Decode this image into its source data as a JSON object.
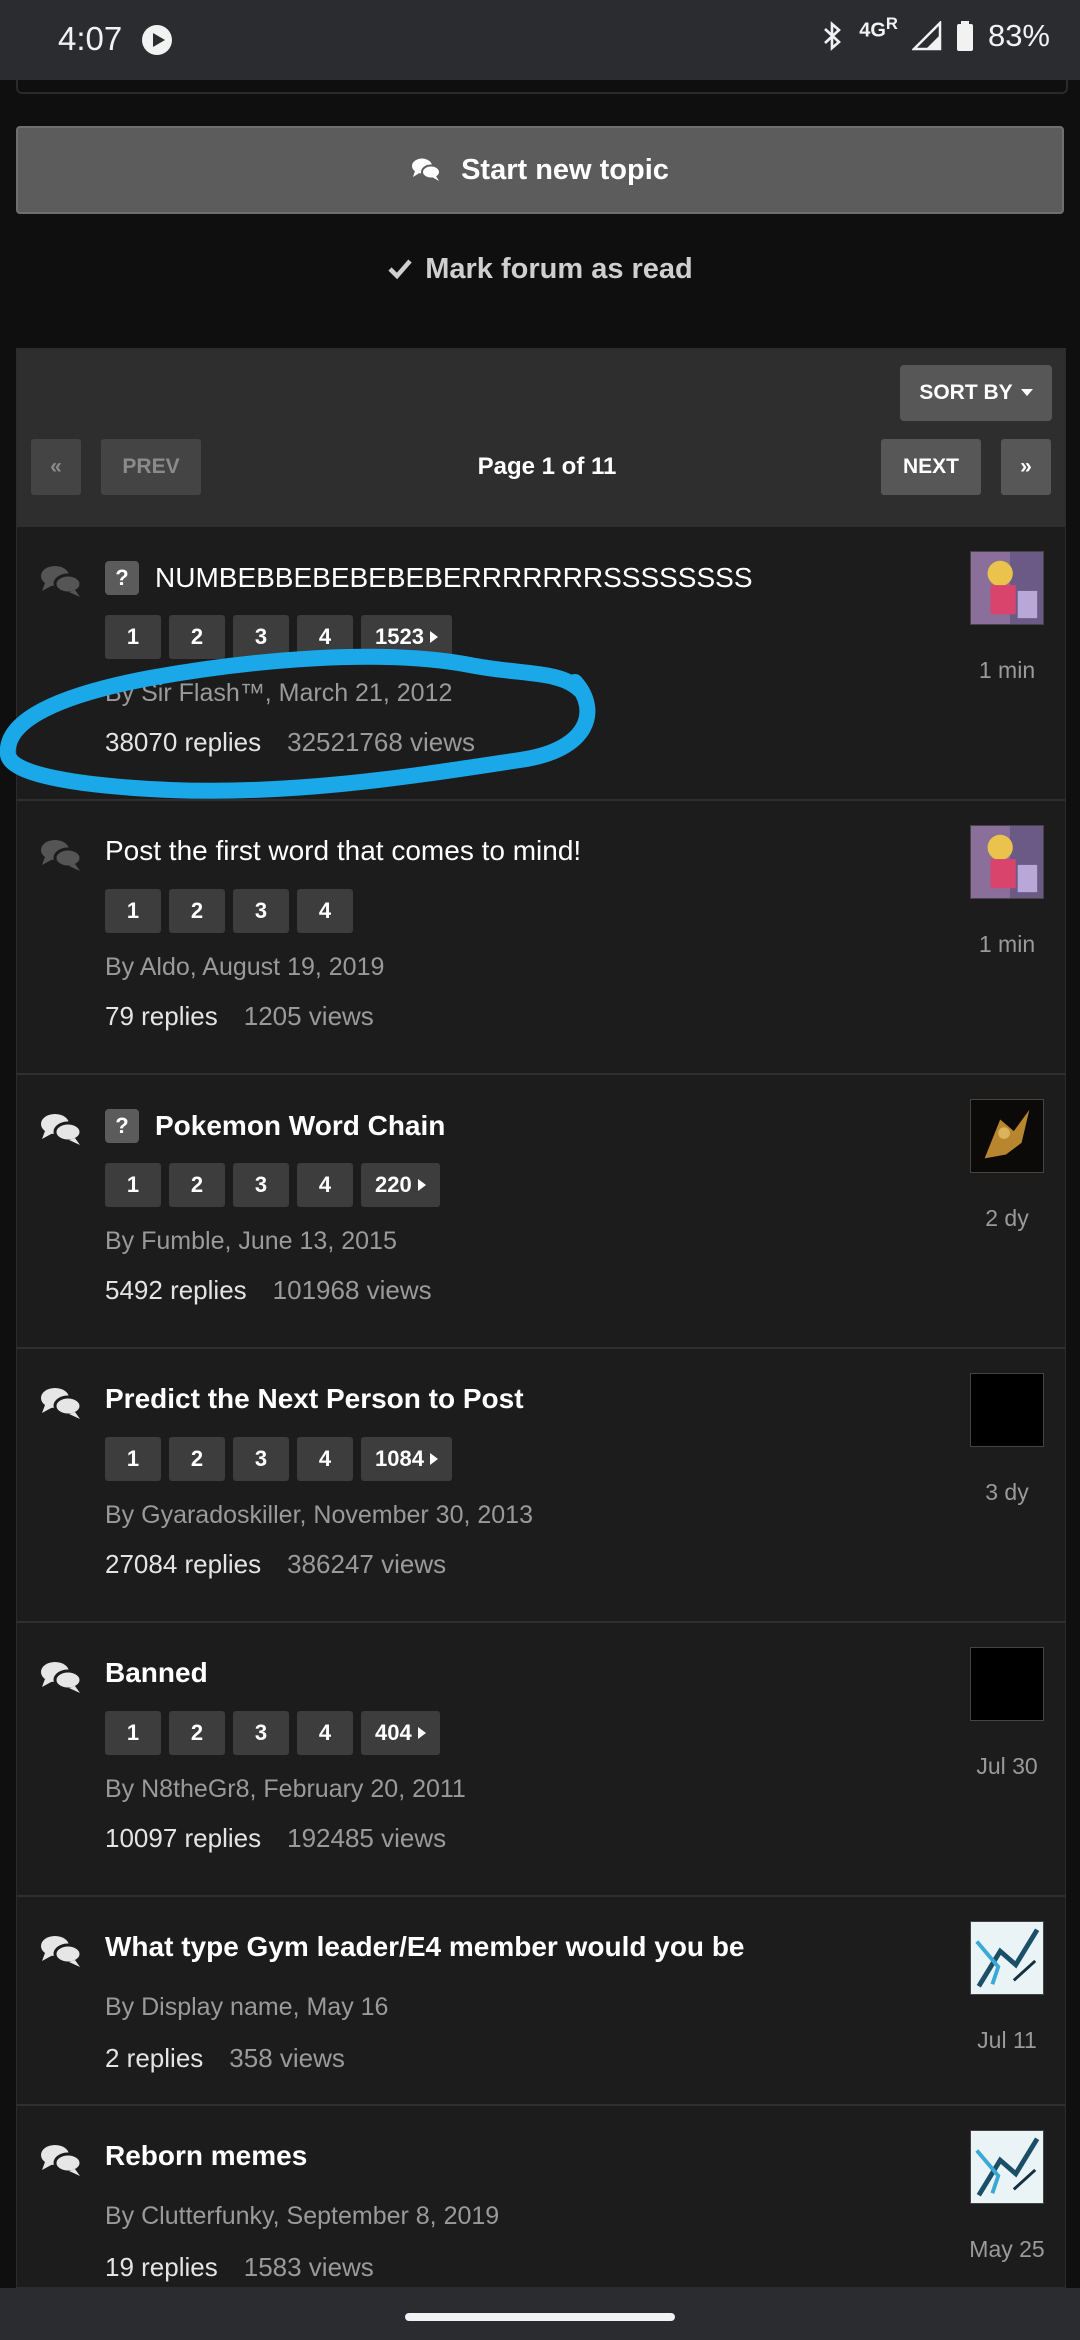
{
  "status_bar": {
    "time": "4:07",
    "network": "4G",
    "network_sup": "R",
    "battery": "83%",
    "icons": [
      "play-icon",
      "bluetooth-icon",
      "signal-icon",
      "battery-icon"
    ]
  },
  "actions": {
    "start_topic": "Start new topic",
    "mark_read": "Mark forum as read"
  },
  "toolbar": {
    "sort_by": "SORT BY",
    "first": "«",
    "prev": "PREV",
    "page_info": "Page 1 of 11",
    "next": "NEXT",
    "last": "»"
  },
  "topics": [
    {
      "title": "NUMBEBBEBEBEBEBERRRRRRRSSSSSSSS",
      "has_question": true,
      "question_mark": "?",
      "title_bold": false,
      "pages": [
        "1",
        "2",
        "3",
        "4"
      ],
      "last_page": "1523",
      "byline": "By Sir Flash™, March 21, 2012",
      "replies": "38070 replies",
      "views": "32521768 views",
      "last_post": "1 min",
      "avatar_style": "anime"
    },
    {
      "title": "Post the first word that comes to mind!",
      "has_question": false,
      "title_bold": false,
      "pages": [
        "1",
        "2",
        "3",
        "4"
      ],
      "last_page": "",
      "byline": "By Aldo, August 19, 2019",
      "replies": "79 replies",
      "views": "1205 views",
      "last_post": "1 min",
      "avatar_style": "anime"
    },
    {
      "title": "Pokemon Word Chain",
      "has_question": true,
      "question_mark": "?",
      "title_bold": true,
      "pages": [
        "1",
        "2",
        "3",
        "4"
      ],
      "last_page": "220",
      "byline": "By Fumble, June 13, 2015",
      "replies": "5492 replies",
      "views": "101968 views",
      "last_post": "2 dy",
      "avatar_style": "dark-gold"
    },
    {
      "title": "Predict the Next Person to Post",
      "has_question": false,
      "title_bold": true,
      "pages": [
        "1",
        "2",
        "3",
        "4"
      ],
      "last_page": "1084",
      "byline": "By Gyaradoskiller, November 30, 2013",
      "replies": "27084 replies",
      "views": "386247 views",
      "last_post": "3 dy",
      "avatar_style": "black"
    },
    {
      "title": "Banned",
      "has_question": false,
      "title_bold": true,
      "pages": [
        "1",
        "2",
        "3",
        "4"
      ],
      "last_page": "404",
      "byline": "By N8theGr8, February 20, 2011",
      "replies": "10097 replies",
      "views": "192485 views",
      "last_post": "Jul 30",
      "avatar_style": "black"
    },
    {
      "title": "What type Gym leader/E4 member would you be",
      "has_question": false,
      "title_bold": true,
      "pages": [],
      "last_page": "",
      "byline": "By Display name, May 16",
      "replies": "2 replies",
      "views": "358 views",
      "last_post": "Jul 11",
      "avatar_style": "sketch"
    },
    {
      "title": "Reborn memes",
      "has_question": false,
      "title_bold": true,
      "pages": [],
      "last_page": "",
      "byline": "By Clutterfunky, September 8, 2019",
      "replies": "19 replies",
      "views": "1583 views",
      "last_post": "May 25",
      "avatar_style": "sketch"
    }
  ],
  "colors": {
    "background": "#0f0f0f",
    "panel": "#1c1c1c",
    "button": "#5c5c5c",
    "annotation": "#1aa8e8"
  }
}
